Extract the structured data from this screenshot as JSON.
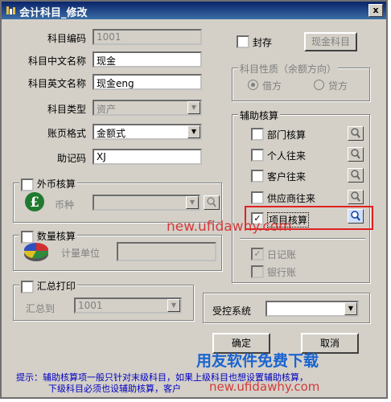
{
  "window": {
    "title": "会计科目_修改",
    "close": "x"
  },
  "form": {
    "code_label": "科目编码",
    "code_value": "1001",
    "cn_label": "科目中文名称",
    "cn_value": "现金",
    "en_label": "科目英文名称",
    "en_value": "现金eng",
    "type_label": "科目类型",
    "type_value": "资产",
    "format_label": "账页格式",
    "format_value": "金额式",
    "mnemonic_label": "助记码",
    "mnemonic_value": "XJ"
  },
  "seal": {
    "label": "封存",
    "cash_button": "现金科目"
  },
  "nature": {
    "title": "科目性质（余额方向）",
    "debit": "借方",
    "credit": "贷方"
  },
  "foreign": {
    "title": "外币核算",
    "currency_label": "币种"
  },
  "quantity": {
    "title": "数量核算",
    "unit_label": "计量单位"
  },
  "summary": {
    "title": "汇总打印",
    "to_label": "汇总到",
    "to_value": "1001"
  },
  "aux": {
    "title": "辅助核算",
    "items": [
      {
        "label": "部门核算",
        "checked": ""
      },
      {
        "label": "个人往来",
        "checked": ""
      },
      {
        "label": "客户往来",
        "checked": ""
      },
      {
        "label": "供应商往来",
        "checked": ""
      },
      {
        "label": "项目核算",
        "checked": "✓"
      }
    ]
  },
  "journals": {
    "daily": "日记账",
    "bank": "银行账",
    "daily_checked": "✓"
  },
  "control": {
    "label": "受控系统",
    "value": ""
  },
  "buttons": {
    "ok": "确定",
    "cancel": "取消"
  },
  "hint": {
    "line1": "提示：辅助核算项一般只针对末级科目，如果上级科目也想设置辅助核算，",
    "line2": "下级科目必须也设辅助核算，客户"
  },
  "watermark": {
    "url": "new.ufidawhy.com",
    "brand": "用友软件免费下载",
    "url2": "new.ufidawhy.com"
  }
}
